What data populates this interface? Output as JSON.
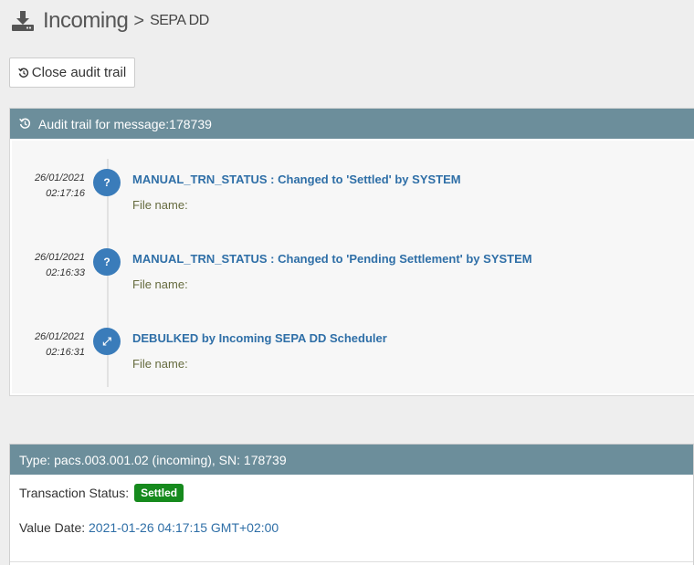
{
  "header": {
    "title": "Incoming",
    "separator": ">",
    "subtitle": "SEPA DD",
    "icon": "download-icon"
  },
  "toolbar": {
    "close_audit_label": "Close audit trail",
    "close_audit_icon": "history-icon"
  },
  "audit": {
    "heading": "Audit trail for message:178739",
    "entries": [
      {
        "date": "26/01/2021",
        "time": "02:17:16",
        "icon": "question-icon",
        "glyph": "?",
        "message": "MANUAL_TRN_STATUS : Changed to 'Settled' by SYSTEM",
        "file_label": "File name:"
      },
      {
        "date": "26/01/2021",
        "time": "02:16:33",
        "icon": "question-icon",
        "glyph": "?",
        "message": "MANUAL_TRN_STATUS : Changed to 'Pending Settlement' by SYSTEM",
        "file_label": "File name:"
      },
      {
        "date": "26/01/2021",
        "time": "02:16:31",
        "icon": "expand-icon",
        "glyph": "⤢",
        "message": "DEBULKED by Incoming SEPA DD Scheduler",
        "file_label": "File name:"
      }
    ]
  },
  "details": {
    "heading": "Type: pacs.003.001.02 (incoming), SN: 178739",
    "status_label": "Transaction Status:",
    "status_value": "Settled",
    "value_date_label": "Value Date:",
    "value_date": "2021-01-26 04:17:15 GMT+02:00"
  },
  "colors": {
    "panel_header": "#6c8e9b",
    "link": "#2f6fa7",
    "badge": "#3a7cba",
    "status_settled": "#168a1d"
  }
}
